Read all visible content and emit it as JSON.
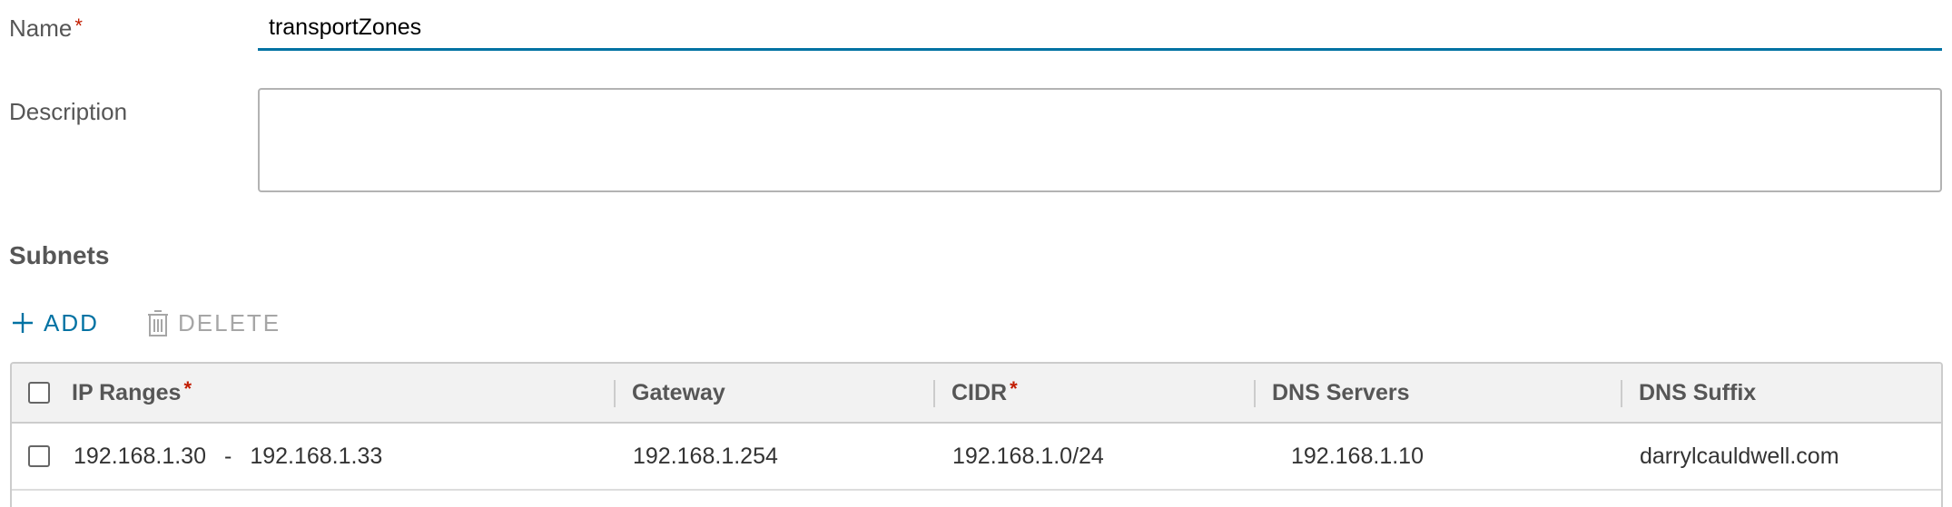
{
  "form": {
    "name_label": "Name",
    "name_value": "transportZones",
    "required_mark": "*",
    "description_label": "Description",
    "description_value": ""
  },
  "subnets": {
    "title": "Subnets",
    "add_label": "ADD",
    "delete_label": "DELETE",
    "columns": {
      "ip_ranges": "IP Ranges",
      "gateway": "Gateway",
      "cidr": "CIDR",
      "dns_servers": "DNS Servers",
      "dns_suffix": "DNS Suffix"
    },
    "rows": [
      {
        "ip_start": "192.168.1.30",
        "range_separator": "-",
        "ip_end": "192.168.1.33",
        "gateway": "192.168.1.254",
        "cidr": "192.168.1.0/24",
        "dns_servers": "192.168.1.10",
        "dns_suffix": "darrylcauldwell.com"
      }
    ]
  },
  "colors": {
    "accent": "#0072a3",
    "required": "#c21d00",
    "disabled": "#a6a6a6",
    "header_bg": "#f2f2f2"
  },
  "icons": {
    "add": "plus-icon",
    "delete": "trash-icon"
  }
}
